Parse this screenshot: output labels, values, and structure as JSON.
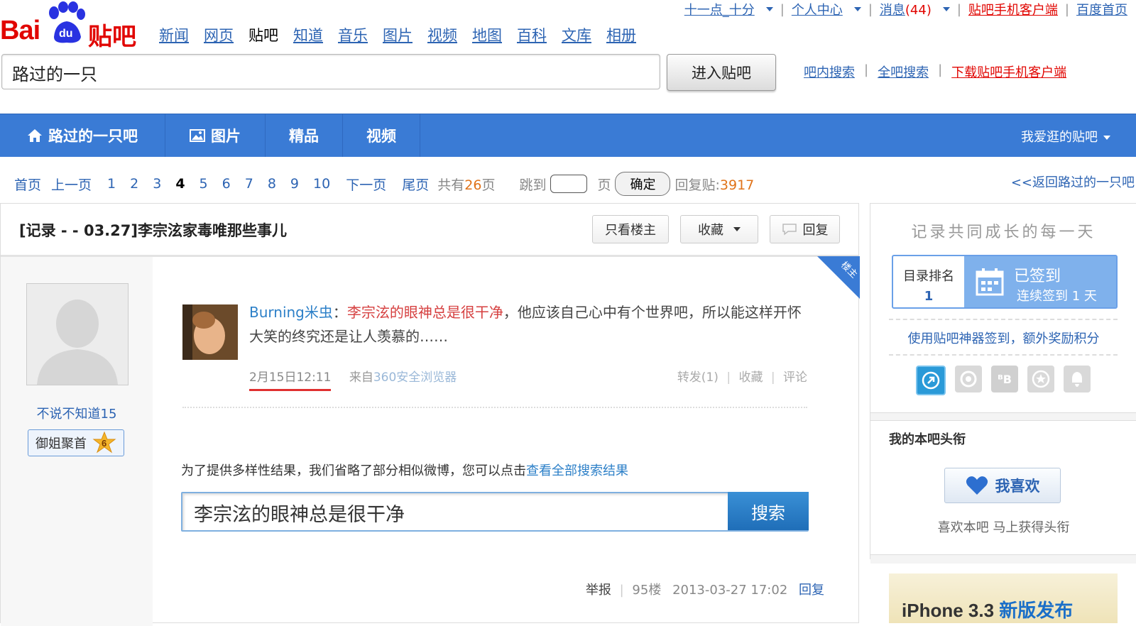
{
  "topbar": {
    "username": "十一点_十分",
    "personal": "个人中心",
    "messages_label": "消息",
    "messages_count": "(44)",
    "mobile_client": "贴吧手机客户端",
    "baidu_home": "百度首页"
  },
  "logo": {
    "bai": "Bai",
    "du": "du",
    "tieba": "贴吧"
  },
  "nav": {
    "items": [
      "新闻",
      "网页",
      "贴吧",
      "知道",
      "音乐",
      "图片",
      "视频",
      "地图",
      "百科",
      "文库",
      "相册"
    ],
    "current": "贴吧"
  },
  "search": {
    "value": "路过的一只",
    "enter_button": "进入贴吧",
    "links": [
      "吧内搜索",
      "全吧搜索",
      "下载贴吧手机客户端"
    ]
  },
  "banner": {
    "tabs": [
      "路过的一只吧",
      "图片",
      "精品",
      "视频"
    ],
    "favorites": "我爱逛的贴吧",
    "color": "#3a7bd5"
  },
  "pager": {
    "first": "首页",
    "prev": "上一页",
    "pages": [
      "1",
      "2",
      "3",
      "4",
      "5",
      "6",
      "7",
      "8",
      "9",
      "10"
    ],
    "current": "4",
    "next": "下一页",
    "last": "尾页",
    "total_prefix": "共有",
    "total_pages": "26",
    "total_suffix": "页",
    "jump_prefix": "跳到",
    "jump_suffix": "页",
    "confirm": "确定",
    "reply_label": "回复贴:",
    "reply_count": "3917",
    "back": "<<返回路过的一只吧"
  },
  "thread": {
    "title": "[记录 - - 03.27]李宗泫家毒唯那些事儿",
    "only_op": "只看楼主",
    "collect": "收藏",
    "reply": "回复"
  },
  "post": {
    "author": "不说不知道15",
    "badge": "御姐聚首",
    "level": "6",
    "corner_tag": "楼主",
    "weibo_user": "Burning米虫",
    "weibo_colon": "：",
    "weibo_highlight": "李宗泫的眼神总是很干净",
    "weibo_rest": "，他应该自己心中有个世界吧，所以能这样开怀大笑的终究还是让人羡慕的……",
    "weibo_time": "2月15日12:11",
    "weibo_source_prefix": "来自",
    "weibo_source": "360安全浏览器",
    "weibo_forward": "转发(1)",
    "weibo_collect": "收藏",
    "weibo_comment": "评论",
    "note_text": "为了提供多样性结果，我们省略了部分相似微博，您可以点击",
    "note_link": "查看全部搜索结果",
    "search_query": "李宗泫的眼神总是很干净",
    "search_button": "搜索",
    "report": "举报",
    "floor": "95楼",
    "datetime": "2013-03-27 17:02",
    "reply": "回复"
  },
  "sidebar": {
    "slogan": "记录共同成长的每一天",
    "rank_label": "目录排名",
    "rank_value": "1",
    "signed": "已签到",
    "streak": "连续签到 1 天",
    "promo": "使用贴吧神器签到，额外奖励积分",
    "icons": [
      "tieba-app-icon",
      "browser-icon",
      "bb-icon",
      "star-icon",
      "bell-icon"
    ],
    "title_section": "我的本吧头衔",
    "like_button": "我喜欢",
    "like_sub": "喜欢本吧 马上获得头衔",
    "ad_prefix": "iPhone 3.3 ",
    "ad_highlight": "新版发布"
  },
  "colors": {
    "accent_blue": "#3a7bd5",
    "link": "#2d64b3",
    "red": "#e10602",
    "orange": "#e0731a"
  }
}
